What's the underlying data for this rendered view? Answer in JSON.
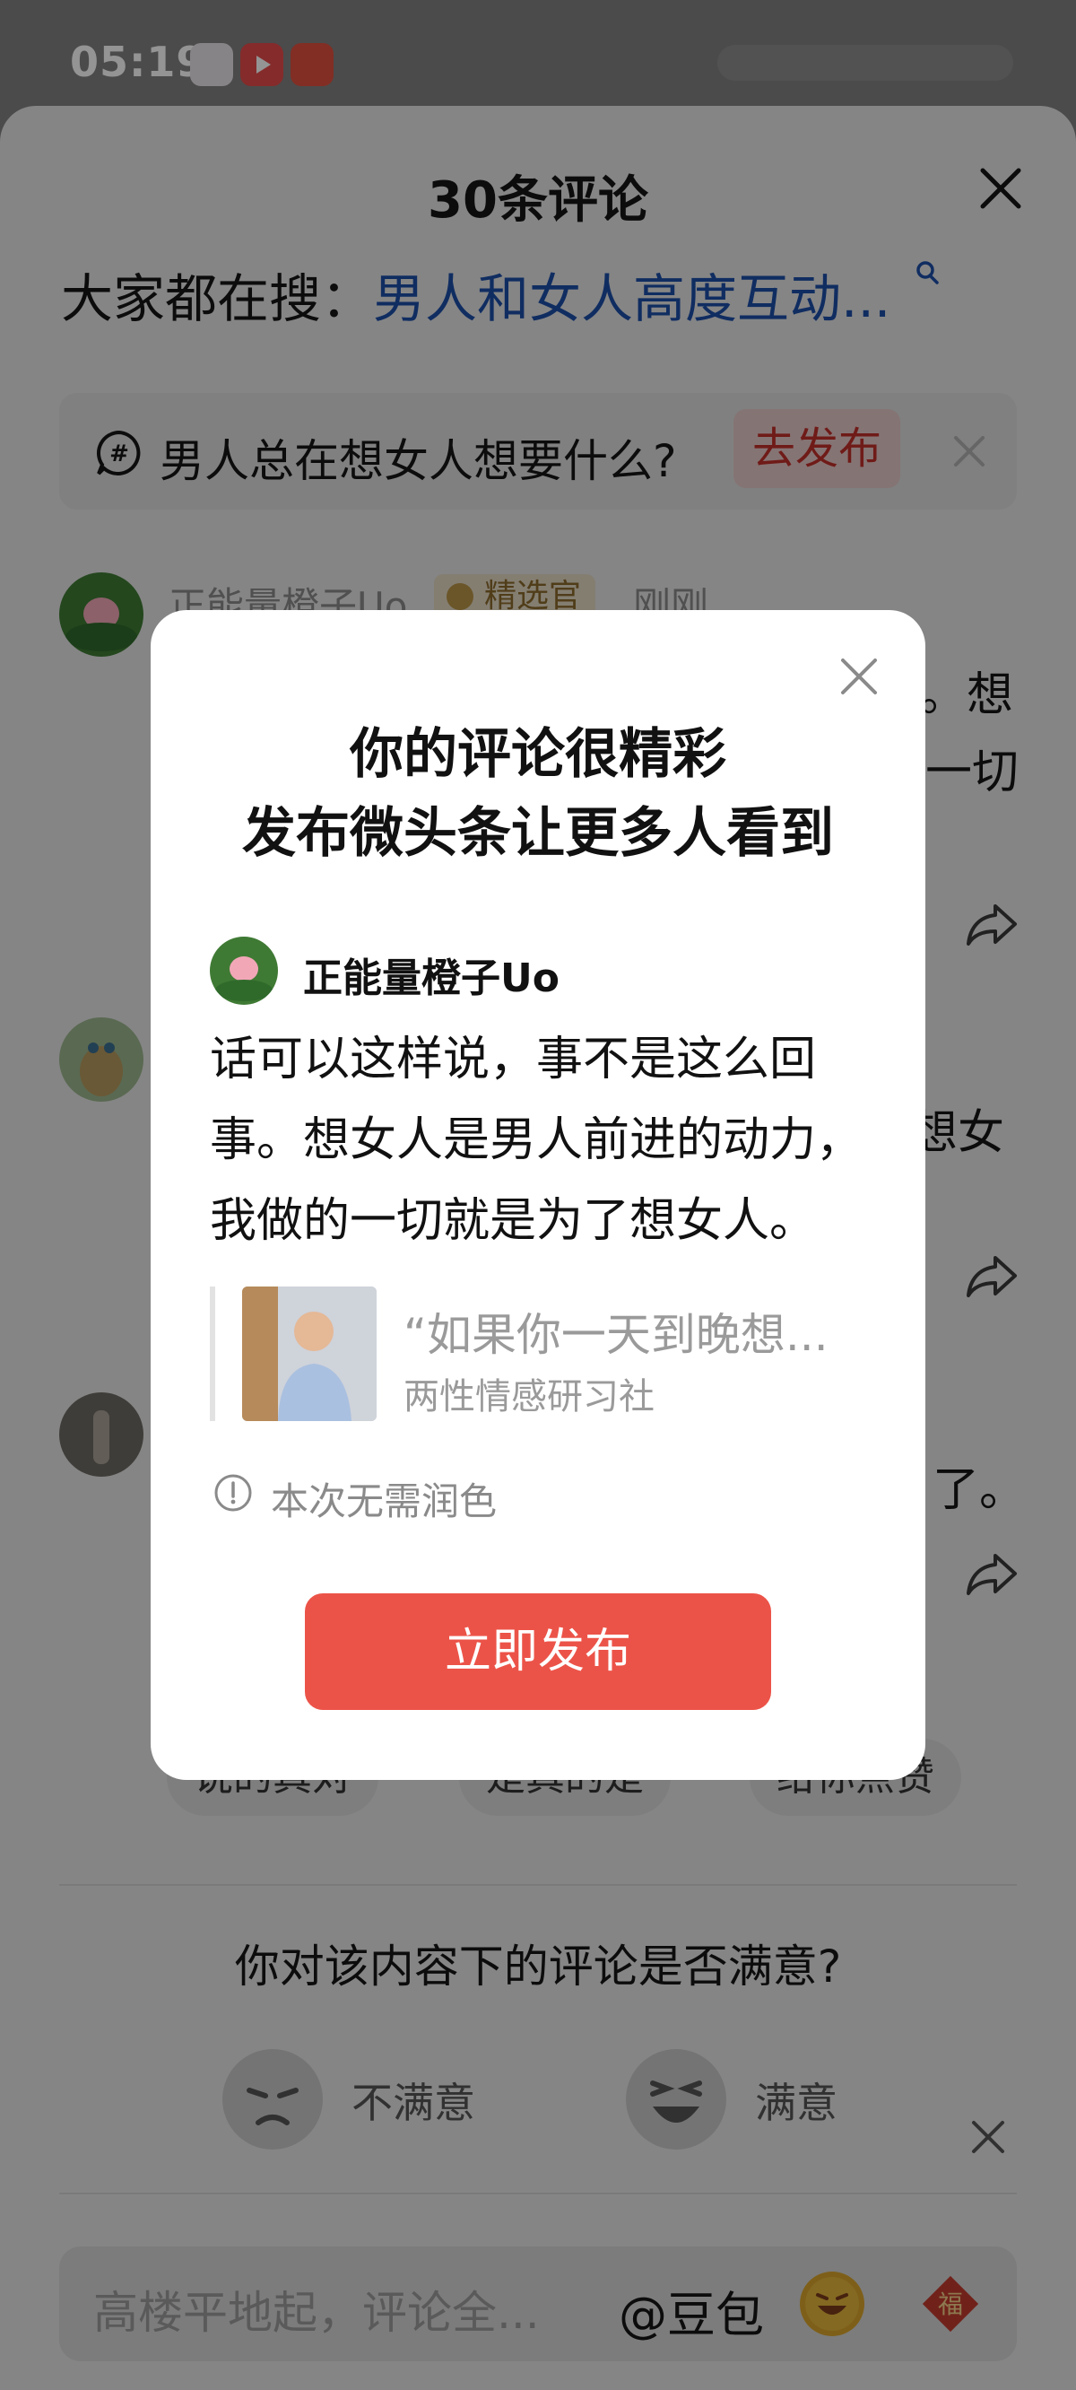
{
  "status_bar": {
    "time": "05:19"
  },
  "sheet": {
    "title": "30条评论",
    "search_label": "大家都在搜：",
    "search_query": "男人和女人高度互动..."
  },
  "topic": {
    "text": "男人总在想女人想要什么?",
    "publish_label": "去发布"
  },
  "comments": [
    {
      "user": "正能量橙子Uo",
      "badge": "精选官",
      "time": "刚刚",
      "frag1": "。想",
      "frag2": "一切"
    },
    {
      "frag1": "想女"
    },
    {
      "frag1": "了。"
    }
  ],
  "reactions": [
    "说的真对",
    "是真的是",
    "给你点赞"
  ],
  "survey": {
    "question": "你对该内容下的评论是否满意?",
    "options": [
      "不满意",
      "满意"
    ]
  },
  "input_bar": {
    "placeholder": "高楼平地起，评论全...",
    "mention": "@豆包"
  },
  "modal": {
    "title_line1": "你的评论很精彩",
    "title_line2": "发布微头条让更多人看到",
    "user": "正能量橙子Uo",
    "body_line1": "话可以这样说，事不是这么回",
    "body_line2": "事。想女人是男人前进的动力，",
    "body_line3": "我做的一切就是为了想女人。",
    "quote_text": "“如果你一天到晚想...",
    "quote_source": "两性情感研习社",
    "polish_note": "本次无需润色",
    "publish_button": "立即发布"
  },
  "colors": {
    "accent_red": "#ec5348",
    "search_link_blue": "#1d4ea8",
    "badge_gold": "#b89448"
  }
}
